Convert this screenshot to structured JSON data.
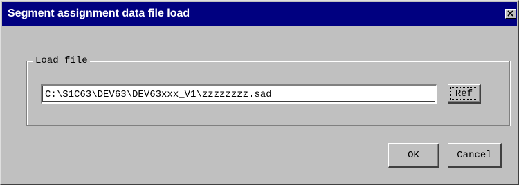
{
  "window": {
    "title": "Segment assignment data file load",
    "close_icon": "close-icon"
  },
  "load_group": {
    "label": "Load file",
    "path_value": "C:\\S1C63\\DEV63\\DEV63xxx_V1\\zzzzzzzz.sad",
    "ref_label": "Ref"
  },
  "buttons": {
    "ok_label": "OK",
    "cancel_label": "Cancel"
  },
  "colors": {
    "titlebar": "#000080",
    "face": "#c0c0c0"
  }
}
